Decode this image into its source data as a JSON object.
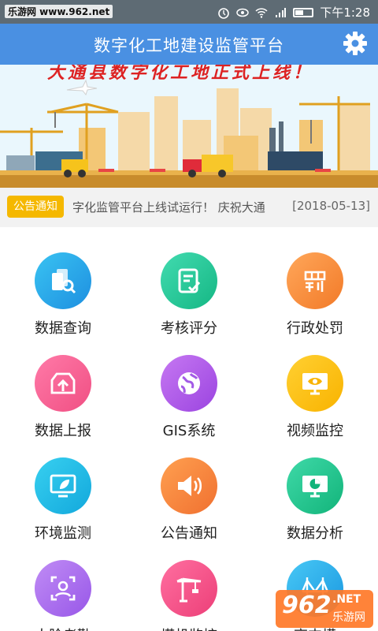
{
  "status_bar": {
    "watermark": "乐游网 www.962.net",
    "time": "下午1:28"
  },
  "app": {
    "title": "数字化工地建设监管平台"
  },
  "banner": {
    "headline": "大通县数字化工地正式上线！"
  },
  "notice": {
    "badge": "公告通知",
    "text": "字化监管平台上线试运行！  庆祝大通",
    "date": "[2018-05-13]"
  },
  "menu": [
    {
      "label": "数据查询",
      "icon": "data-query-icon"
    },
    {
      "label": "考核评分",
      "icon": "assessment-icon"
    },
    {
      "label": "行政处罚",
      "icon": "penalty-icon"
    },
    {
      "label": "数据上报",
      "icon": "upload-icon"
    },
    {
      "label": "GIS系统",
      "icon": "globe-icon"
    },
    {
      "label": "视频监控",
      "icon": "video-monitor-icon"
    },
    {
      "label": "环境监测",
      "icon": "environment-icon"
    },
    {
      "label": "公告通知",
      "icon": "speaker-icon"
    },
    {
      "label": "数据分析",
      "icon": "analytics-icon"
    },
    {
      "label": "人脸考勤",
      "icon": "face-icon"
    },
    {
      "label": "塔机监控",
      "icon": "crane-icon"
    },
    {
      "label": "高支模",
      "icon": "bridge-icon"
    }
  ],
  "bottom_watermark": {
    "logo": "962",
    "net": ".NET",
    "name": "乐游网"
  }
}
